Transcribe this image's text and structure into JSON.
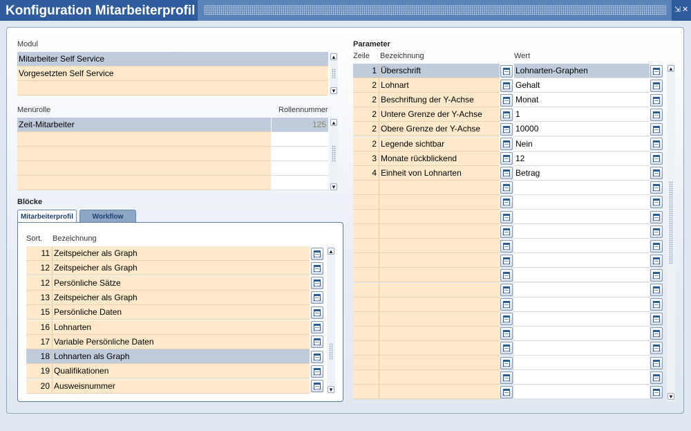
{
  "window": {
    "title": "Konfiguration Mitarbeiterprofil",
    "restore_icon": "restore-icon",
    "close_icon": "close-icon"
  },
  "modul": {
    "label": "Modul",
    "rows": [
      {
        "text": "Mitarbeiter Self Service",
        "selected": true
      },
      {
        "text": "Vorgesetzten Self Service",
        "selected": false
      },
      {
        "text": "",
        "selected": false
      }
    ]
  },
  "menurolle": {
    "label": "Menürolle",
    "number_label": "Rollennummer",
    "rows": [
      {
        "text": "Zeit-Mitarbeiter",
        "number": "125",
        "selected": true
      },
      {
        "text": "",
        "number": ""
      },
      {
        "text": "",
        "number": ""
      },
      {
        "text": "",
        "number": ""
      },
      {
        "text": "",
        "number": ""
      }
    ]
  },
  "bloecke": {
    "label": "Blöcke",
    "tabs": [
      {
        "label": "Mitarbeiterprofil",
        "active": true
      },
      {
        "label": "Workflow",
        "active": false
      }
    ],
    "col_sort": "Sort.",
    "col_bezeichnung": "Bezeichnung",
    "rows": [
      {
        "sort": "11",
        "text": "Zeitspeicher als Graph"
      },
      {
        "sort": "12",
        "text": "Zeitspeicher als Graph"
      },
      {
        "sort": "12",
        "text": "Persönliche Sätze"
      },
      {
        "sort": "13",
        "text": "Zeitspeicher als Graph"
      },
      {
        "sort": "15",
        "text": "Persönliche Daten"
      },
      {
        "sort": "16",
        "text": "Lohnarten"
      },
      {
        "sort": "17",
        "text": "Variable Persönliche Daten"
      },
      {
        "sort": "18",
        "text": "Lohnarten als Graph",
        "selected": true
      },
      {
        "sort": "19",
        "text": "Qualifikationen"
      },
      {
        "sort": "20",
        "text": "Ausweisnummer"
      }
    ]
  },
  "parameter": {
    "label": "Parameter",
    "col_zeile": "Zeile",
    "col_bezeichnung": "Bezeichnung",
    "col_wert": "Wert",
    "rows": [
      {
        "zeile": "1",
        "bez": "Überschrift",
        "wert": "Lohnarten-Graphen",
        "selected": true
      },
      {
        "zeile": "2",
        "bez": "Lohnart",
        "wert": "Gehalt"
      },
      {
        "zeile": "2",
        "bez": "Beschriftung der Y-Achse",
        "wert": "Monat"
      },
      {
        "zeile": "2",
        "bez": "Untere Grenze der Y-Achse",
        "wert": "1"
      },
      {
        "zeile": "2",
        "bez": "Obere Grenze der Y-Achse",
        "wert": "10000"
      },
      {
        "zeile": "2",
        "bez": "Legende sichtbar",
        "wert": "Nein"
      },
      {
        "zeile": "3",
        "bez": "Monate rückblickend",
        "wert": "12"
      },
      {
        "zeile": "4",
        "bez": "Einheit von Lohnarten",
        "wert": "Betrag"
      },
      {
        "zeile": "",
        "bez": "",
        "wert": ""
      },
      {
        "zeile": "",
        "bez": "",
        "wert": ""
      },
      {
        "zeile": "",
        "bez": "",
        "wert": ""
      },
      {
        "zeile": "",
        "bez": "",
        "wert": ""
      },
      {
        "zeile": "",
        "bez": "",
        "wert": ""
      },
      {
        "zeile": "",
        "bez": "",
        "wert": ""
      },
      {
        "zeile": "",
        "bez": "",
        "wert": ""
      },
      {
        "zeile": "",
        "bez": "",
        "wert": ""
      },
      {
        "zeile": "",
        "bez": "",
        "wert": ""
      },
      {
        "zeile": "",
        "bez": "",
        "wert": ""
      },
      {
        "zeile": "",
        "bez": "",
        "wert": ""
      },
      {
        "zeile": "",
        "bez": "",
        "wert": ""
      },
      {
        "zeile": "",
        "bez": "",
        "wert": ""
      },
      {
        "zeile": "",
        "bez": "",
        "wert": ""
      },
      {
        "zeile": "",
        "bez": "",
        "wert": ""
      }
    ]
  },
  "colors": {
    "title_bg": "#2f5c9c",
    "row_bg": "#feeacb",
    "selected_bg": "#c0ccdb"
  }
}
